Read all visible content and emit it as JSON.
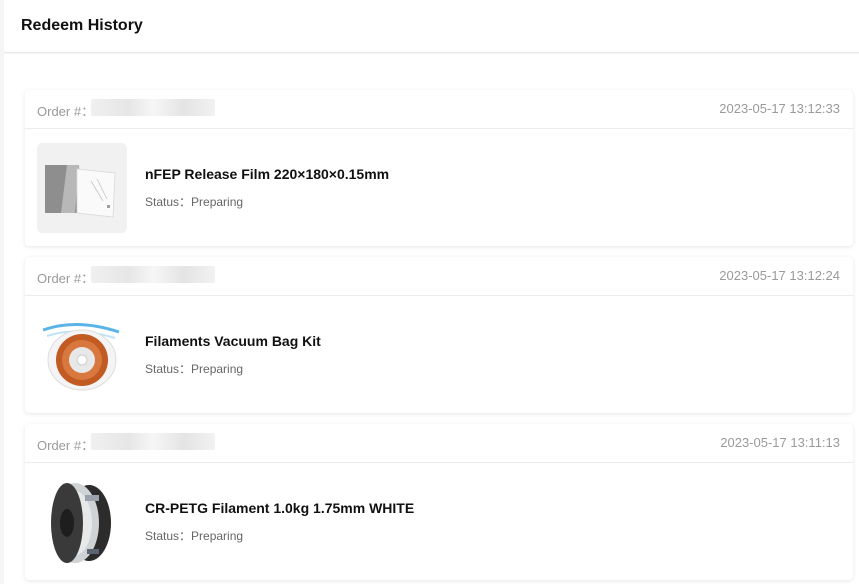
{
  "header": {
    "title": "Redeem History"
  },
  "order_label": "Order #：",
  "status_prefix": "Status：",
  "orders": [
    {
      "time": "2023-05-17 13:12:33",
      "product": "nFEP Release Film 220×180×0.15mm",
      "status": "Preparing",
      "image": "release-film-image"
    },
    {
      "time": "2023-05-17 13:12:24",
      "product": "Filaments Vacuum Bag Kit",
      "status": "Preparing",
      "image": "vacuum-bag-kit-image"
    },
    {
      "time": "2023-05-17 13:11:13",
      "product": "CR-PETG Filament 1.0kg 1.75mm WHITE",
      "status": "Preparing",
      "image": "petg-filament-spool-image"
    }
  ]
}
